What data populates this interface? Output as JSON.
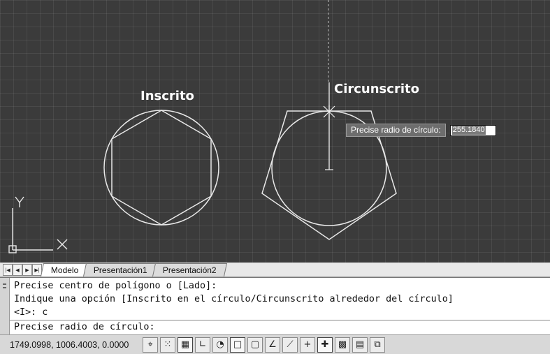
{
  "canvas": {
    "label_inscribed": "Inscrito",
    "label_circumscribed": "Circunscrito",
    "ucs_y": "Y",
    "ucs_x": "X",
    "tooltip_prompt": "Precise radio de círculo:",
    "tooltip_value": "255.1840",
    "colors": {
      "background": "#3b3b3b",
      "lines": "#e8e8e8"
    }
  },
  "tabs": [
    {
      "label": "Modelo",
      "active": true
    },
    {
      "label": "Presentación1",
      "active": false
    },
    {
      "label": "Presentación2",
      "active": false
    }
  ],
  "nav_icons": [
    "first-tab-icon",
    "prev-tab-icon",
    "next-tab-icon",
    "last-tab-icon"
  ],
  "command_line": {
    "history": [
      "Precise centro de polígono o [Lado]:",
      "Indique una opción [Inscrito en el círculo/Circunscrito alrededor del círculo]",
      "<I>: c"
    ],
    "prompt": "Precise radio de círculo:"
  },
  "status_bar": {
    "coordinates": "1749.0998, 1006.4003, 0.0000",
    "toggle_icons": [
      "infer-constraints-icon",
      "snap-mode-icon",
      "grid-display-icon",
      "ortho-mode-icon",
      "polar-tracking-icon",
      "object-snap-icon",
      "3d-object-snap-icon",
      "object-snap-tracking-icon",
      "dynamic-ucs-icon",
      "dynamic-input-icon",
      "lineweight-icon",
      "transparency-icon",
      "quick-properties-icon",
      "selection-cycling-icon"
    ]
  }
}
